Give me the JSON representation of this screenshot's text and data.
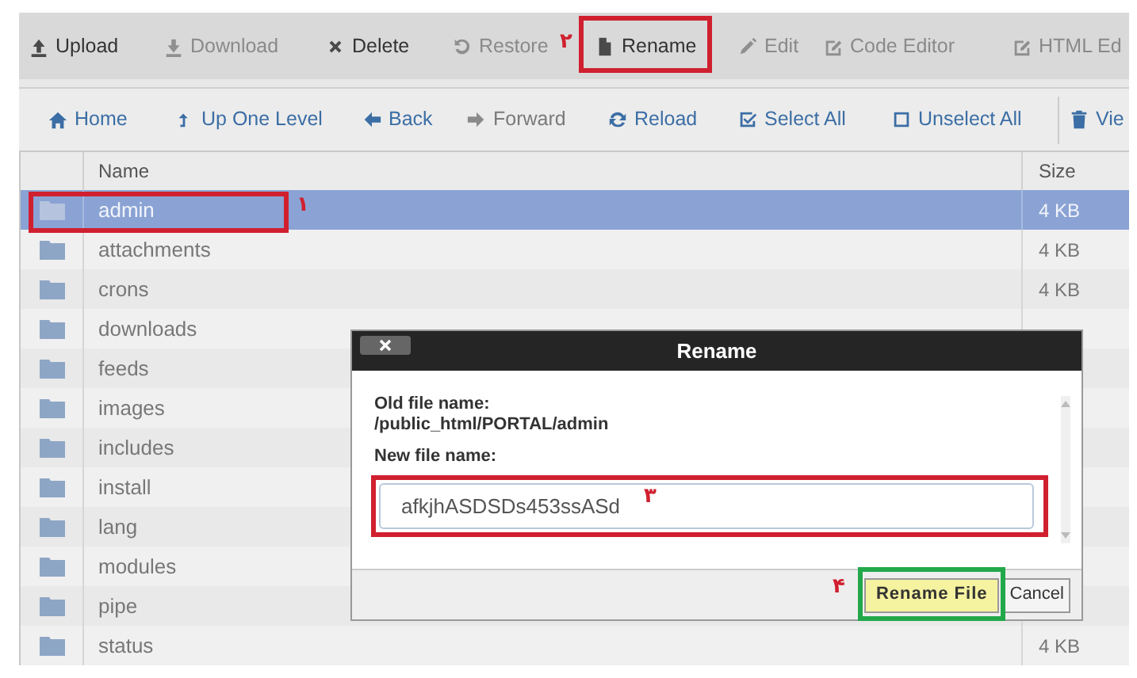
{
  "toolbar": [
    {
      "label": "Upload",
      "kind": "upload",
      "disabled": false
    },
    {
      "label": "Download",
      "kind": "download",
      "disabled": true
    },
    {
      "label": "Delete",
      "kind": "delete",
      "disabled": false
    },
    {
      "label": "Restore",
      "kind": "restore",
      "disabled": true
    },
    {
      "label": "Rename",
      "kind": "rename",
      "disabled": false
    },
    {
      "label": "Edit",
      "kind": "edit",
      "disabled": true
    },
    {
      "label": "Code Editor",
      "kind": "code-editor",
      "disabled": true
    },
    {
      "label": "HTML Ed",
      "kind": "html-editor",
      "disabled": true
    }
  ],
  "nav_toolbar": [
    {
      "label": "Home",
      "kind": "home",
      "disabled": false
    },
    {
      "label": "Up One Level",
      "kind": "up",
      "disabled": false
    },
    {
      "label": "Back",
      "kind": "back",
      "disabled": false
    },
    {
      "label": "Forward",
      "kind": "forward",
      "disabled": true
    },
    {
      "label": "Reload",
      "kind": "reload",
      "disabled": false
    },
    {
      "label": "Select All",
      "kind": "select-all",
      "disabled": false
    },
    {
      "label": "Unselect All",
      "kind": "unselect-all",
      "disabled": false
    },
    {
      "label": "Vie",
      "kind": "trash",
      "disabled": false
    }
  ],
  "table": {
    "columns": [
      "Name",
      "Size"
    ],
    "rows": [
      {
        "name": "admin",
        "size": "4 KB",
        "selected": true
      },
      {
        "name": "attachments",
        "size": "4 KB",
        "selected": false
      },
      {
        "name": "crons",
        "size": "4 KB",
        "selected": false
      },
      {
        "name": "downloads",
        "selected": false
      },
      {
        "name": "feeds",
        "selected": false
      },
      {
        "name": "images",
        "selected": false
      },
      {
        "name": "includes",
        "selected": false
      },
      {
        "name": "install",
        "selected": false
      },
      {
        "name": "lang",
        "selected": false
      },
      {
        "name": "modules",
        "selected": false
      },
      {
        "name": "pipe",
        "selected": false
      },
      {
        "name": "status",
        "size": "4 KB",
        "selected": false
      }
    ]
  },
  "dialog": {
    "title": "Rename",
    "old_label": "Old file name:",
    "old_value": "/public_html/PORTAL/admin",
    "new_label": "New file name:",
    "new_value": "afkjhASDSDs453ssASd",
    "buttons": [
      {
        "label": "Rename File",
        "kind": "primary"
      },
      {
        "label": "Cancel",
        "kind": "secondary"
      }
    ]
  },
  "annotations": [
    {
      "label": "۱",
      "color": "#d0202f"
    },
    {
      "label": "۲",
      "color": "#d0202f"
    },
    {
      "label": "۳",
      "color": "#d0202f"
    },
    {
      "label": "۴",
      "color": "#22a84a"
    }
  ]
}
